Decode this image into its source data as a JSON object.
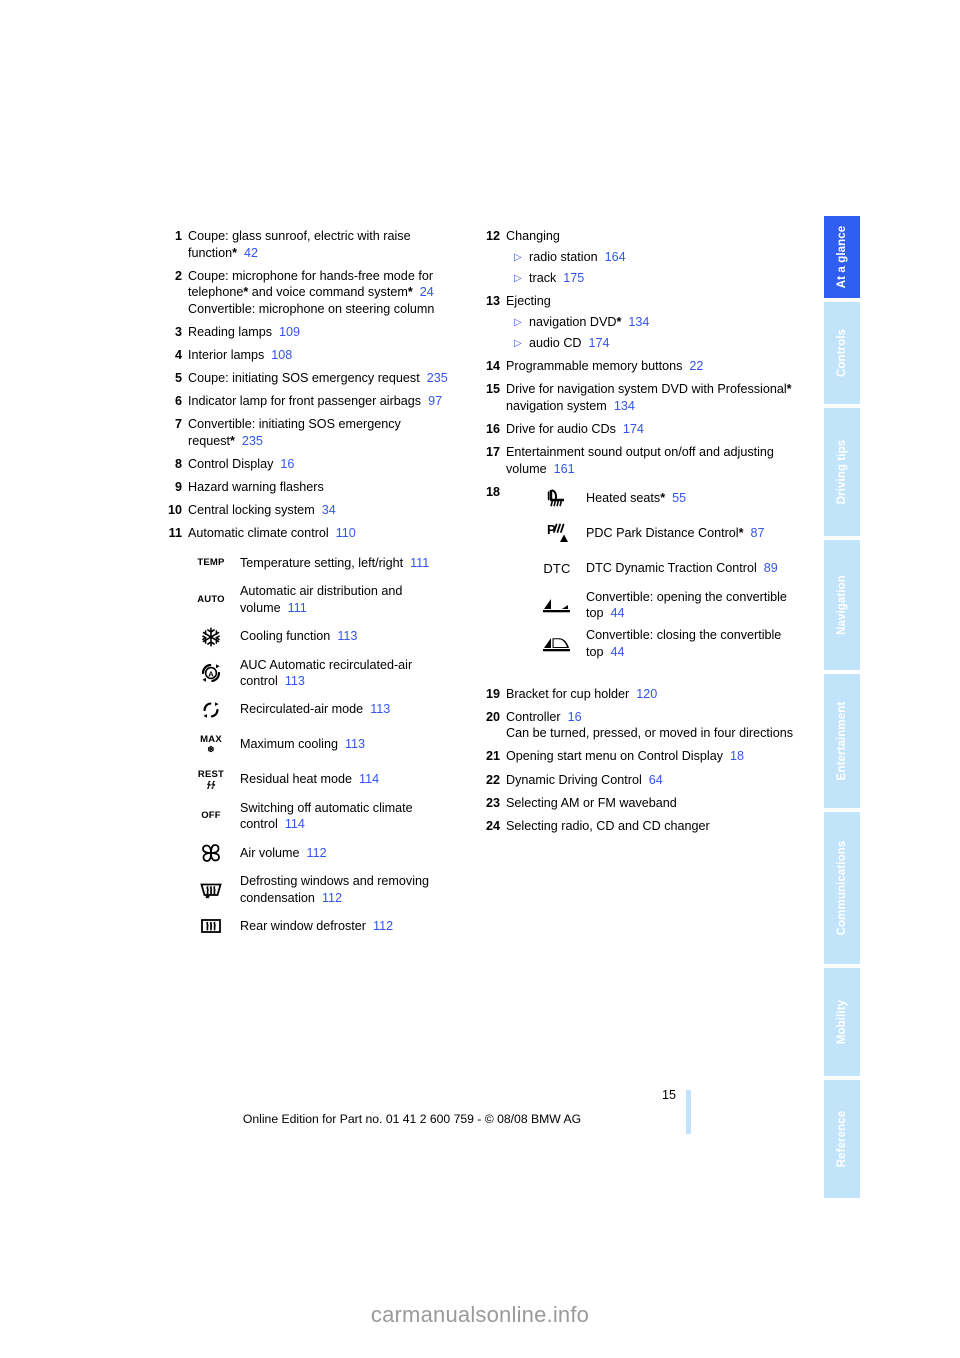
{
  "document": {
    "page_number": "15",
    "footer_text": "Online Edition for Part no. 01 41 2 600 759 - © 08/08 BMW AG",
    "watermark": "carmanualsonline.info",
    "link_color": "#3355ee",
    "tab_active_color": "#2f5ef0",
    "tab_inactive_color": "#c2e4fb"
  },
  "tabs": [
    {
      "label": "At a glance",
      "active": true
    },
    {
      "label": "Controls",
      "active": false
    },
    {
      "label": "Driving tips",
      "active": false
    },
    {
      "label": "Navigation",
      "active": false
    },
    {
      "label": "Entertainment",
      "active": false
    },
    {
      "label": "Communications",
      "active": false
    },
    {
      "label": "Mobility",
      "active": false
    },
    {
      "label": "Reference",
      "active": false
    }
  ],
  "left_column": {
    "items": [
      {
        "num": "1",
        "text": "Coupe: glass sunroof, electric with raise function",
        "star": "*",
        "page": "42"
      },
      {
        "num": "2",
        "text_a": "Coupe: microphone for hands-free mode for telephone",
        "star_a": "*",
        "text_b": " and voice command system",
        "star_b": "*",
        "page": "24",
        "text_c": "Convertible: microphone on steering column"
      },
      {
        "num": "3",
        "text": "Reading lamps",
        "page": "109"
      },
      {
        "num": "4",
        "text": "Interior lamps",
        "page": "108"
      },
      {
        "num": "5",
        "text": "Coupe: initiating SOS emergency request",
        "page": "235"
      },
      {
        "num": "6",
        "text": "Indicator lamp for front passenger airbags",
        "page": "97"
      },
      {
        "num": "7",
        "text": "Convertible: initiating SOS emergency request",
        "star": "*",
        "page": "235"
      },
      {
        "num": "8",
        "text": "Control Display",
        "page": "16"
      },
      {
        "num": "9",
        "text": "Hazard warning flashers",
        "page": ""
      },
      {
        "num": "10",
        "text": "Central locking system",
        "page": "34"
      },
      {
        "num": "11",
        "text": "Automatic climate control",
        "page": "110"
      }
    ],
    "climate_icons": [
      {
        "icon": "temp-icon",
        "glyph": "TEMP",
        "text": "Temperature setting, left/right",
        "page": "111"
      },
      {
        "icon": "auto-icon",
        "glyph": "AUTO",
        "text": "Automatic air distribution and volume",
        "page": "111"
      },
      {
        "icon": "snowflake-icon",
        "glyph": "",
        "text": "Cooling function",
        "page": "113"
      },
      {
        "icon": "auc-recirculation-icon",
        "glyph": "",
        "text": "AUC Automatic recirculated-air control",
        "page": "113"
      },
      {
        "icon": "recirculated-air-icon",
        "glyph": "",
        "text": "Recirculated-air mode",
        "page": "113"
      },
      {
        "icon": "max-cooling-icon",
        "glyph": "MAX",
        "text": "Maximum cooling",
        "page": "113"
      },
      {
        "icon": "residual-heat-icon",
        "glyph": "REST",
        "text": "Residual heat mode",
        "page": "114"
      },
      {
        "icon": "off-icon",
        "glyph": "OFF",
        "text": "Switching off automatic climate control",
        "page": "114"
      },
      {
        "icon": "fan-icon",
        "glyph": "",
        "text": "Air volume",
        "page": "112"
      },
      {
        "icon": "windshield-defrost-icon",
        "glyph": "",
        "text": "Defrosting windows and removing condensation",
        "page": "112"
      },
      {
        "icon": "rear-defroster-icon",
        "glyph": "",
        "text": "Rear window defroster",
        "page": "112"
      }
    ]
  },
  "right_column": {
    "items_top": [
      {
        "num": "12",
        "text": "Changing",
        "subs": [
          {
            "text": "radio station",
            "page": "164"
          },
          {
            "text": "track",
            "page": "175"
          }
        ]
      },
      {
        "num": "13",
        "text": "Ejecting",
        "subs": [
          {
            "text": "navigation DVD",
            "star": "*",
            "page": "134"
          },
          {
            "text": "audio CD",
            "page": "174"
          }
        ]
      },
      {
        "num": "14",
        "text": "Programmable memory buttons",
        "page": "22"
      },
      {
        "num": "15",
        "text_a": "Drive for navigation system DVD with Professional",
        "star_a": "*",
        "text_b": " navigation system",
        "page": "134"
      },
      {
        "num": "16",
        "text": "Drive for audio CDs",
        "page": "174"
      },
      {
        "num": "17",
        "text": "Entertainment sound output on/off and adjusting volume",
        "page": "161"
      }
    ],
    "item_18": {
      "num": "18",
      "icons": [
        {
          "icon": "heated-seats-icon",
          "glyph": "",
          "text": "Heated seats",
          "star": "*",
          "page": "55"
        },
        {
          "icon": "pdc-icon",
          "glyph": "",
          "text": "PDC Park Distance Control",
          "star": "*",
          "page": "87"
        },
        {
          "icon": "dtc-icon",
          "glyph": "DTC",
          "text": "DTC Dynamic Traction Control",
          "page": "89"
        },
        {
          "icon": "convertible-top-open-icon",
          "glyph": "",
          "text": "Convertible: opening the convertible top",
          "page": "44"
        },
        {
          "icon": "convertible-top-close-icon",
          "glyph": "",
          "text": "Convertible: closing the convertible top",
          "page": "44"
        }
      ]
    },
    "items_bottom": [
      {
        "num": "19",
        "text": "Bracket for cup holder",
        "page": "120"
      },
      {
        "num": "20",
        "text": "Controller",
        "page": "16",
        "text_c": "Can be turned, pressed, or moved in four directions"
      },
      {
        "num": "21",
        "text": "Opening start menu on Control Display",
        "page": "18"
      },
      {
        "num": "22",
        "text": "Dynamic Driving Control",
        "page": "64"
      },
      {
        "num": "23",
        "text": "Selecting AM or FM waveband",
        "page": ""
      },
      {
        "num": "24",
        "text": "Selecting radio, CD and CD changer",
        "page": ""
      }
    ]
  }
}
